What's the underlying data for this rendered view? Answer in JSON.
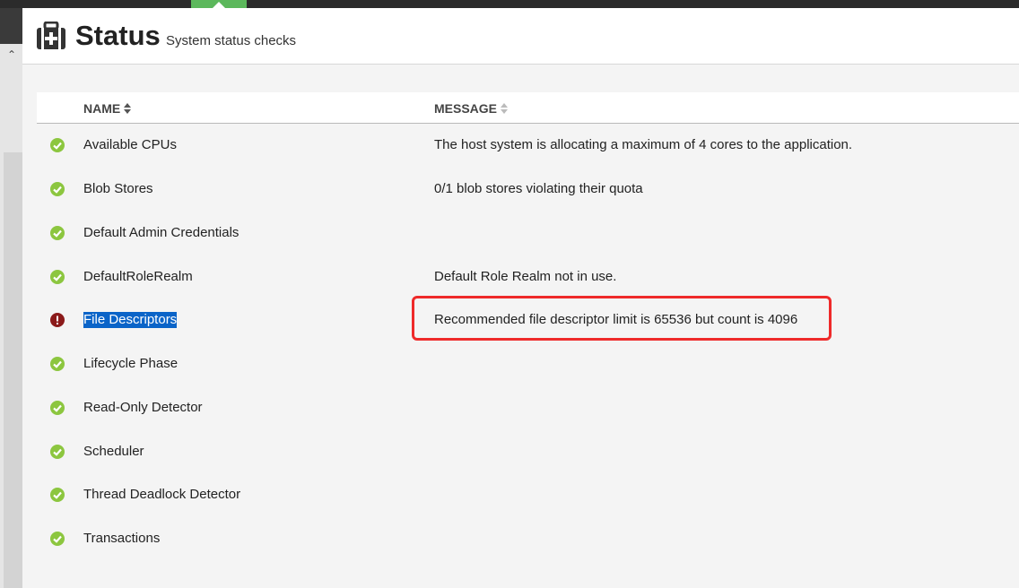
{
  "header": {
    "title": "Status",
    "subtitle": "System status checks",
    "icon": "medical-kit-icon"
  },
  "table": {
    "columns": {
      "name": "NAME",
      "message": "MESSAGE"
    },
    "rows": [
      {
        "name": "Available CPUs",
        "message": "The host system is allocating a maximum of 4 cores to the application.",
        "status": "ok"
      },
      {
        "name": "Blob Stores",
        "message": "0/1 blob stores violating their quota",
        "status": "ok"
      },
      {
        "name": "Default Admin Credentials",
        "message": "",
        "status": "ok"
      },
      {
        "name": "DefaultRoleRealm",
        "message": "Default Role Realm not in use.",
        "status": "ok"
      },
      {
        "name": "File Descriptors",
        "message": "Recommended file descriptor limit is 65536 but count is 4096",
        "status": "error"
      },
      {
        "name": "Lifecycle Phase",
        "message": "",
        "status": "ok"
      },
      {
        "name": "Read-Only Detector",
        "message": "",
        "status": "ok"
      },
      {
        "name": "Scheduler",
        "message": "",
        "status": "ok"
      },
      {
        "name": "Thread Deadlock Detector",
        "message": "",
        "status": "ok"
      },
      {
        "name": "Transactions",
        "message": "",
        "status": "ok"
      }
    ]
  },
  "colors": {
    "ok": "#8cc63f",
    "error": "#8b1a1a",
    "selection": "#0a64c8",
    "annotation": "#ee2a2a"
  }
}
